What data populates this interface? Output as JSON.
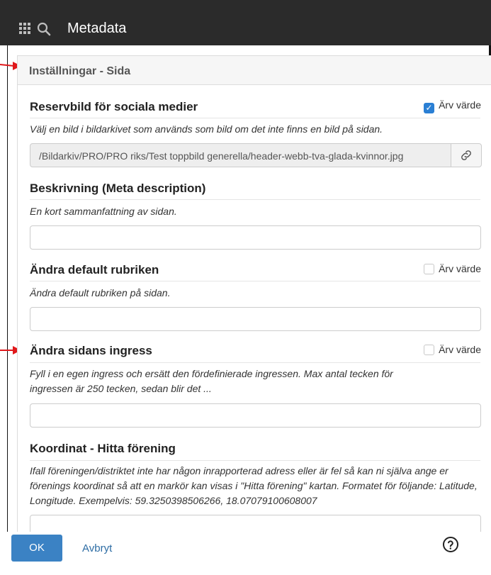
{
  "header": {
    "title": "Metadata",
    "icons": [
      "grid-icon",
      "search-icon"
    ]
  },
  "panel": {
    "title": "Inställningar - Sida"
  },
  "fields": {
    "social_image": {
      "title": "Reservbild för sociala medier",
      "help": "Välj en bild i bildarkivet som används som bild om det inte finns en bild på sidan.",
      "value": "/Bildarkiv/PRO/PRO riks/Test toppbild generella/header-webb-tva-glada-kvinnor.jpg",
      "inherit_label": "Ärv värde",
      "inherit_checked": true
    },
    "description": {
      "title": "Beskrivning (Meta description)",
      "help": "En kort sammanfattning av sidan.",
      "value": ""
    },
    "default_heading": {
      "title": "Ändra default rubriken",
      "help": "Ändra default rubriken på sidan.",
      "value": "",
      "inherit_label": "Ärv värde",
      "inherit_checked": false
    },
    "ingress": {
      "title": "Ändra sidans ingress",
      "help": "Fyll i en egen ingress och ersätt den fördefinierade ingressen. Max antal tecken för ingressen är 250 tecken, sedan blir det ...",
      "value": "",
      "inherit_label": "Ärv värde",
      "inherit_checked": false
    },
    "coordinate": {
      "title": "Koordinat - Hitta förening",
      "help": "Ifall föreningen/distriktet inte har någon inrapporterad adress eller är fel så kan ni själva ange er förenings koordinat så att en markör kan visas i \"Hitta förening\" kartan. Formatet för följande: Latitude, Longitude. Exempelvis: 59.3250398506266, 18.07079100608007",
      "value": ""
    }
  },
  "footer": {
    "ok_label": "OK",
    "cancel_label": "Avbryt"
  },
  "colors": {
    "accent": "#3b82c4",
    "annotation_arrow": "#e0181b",
    "titlebar": "#2b2b2b"
  }
}
